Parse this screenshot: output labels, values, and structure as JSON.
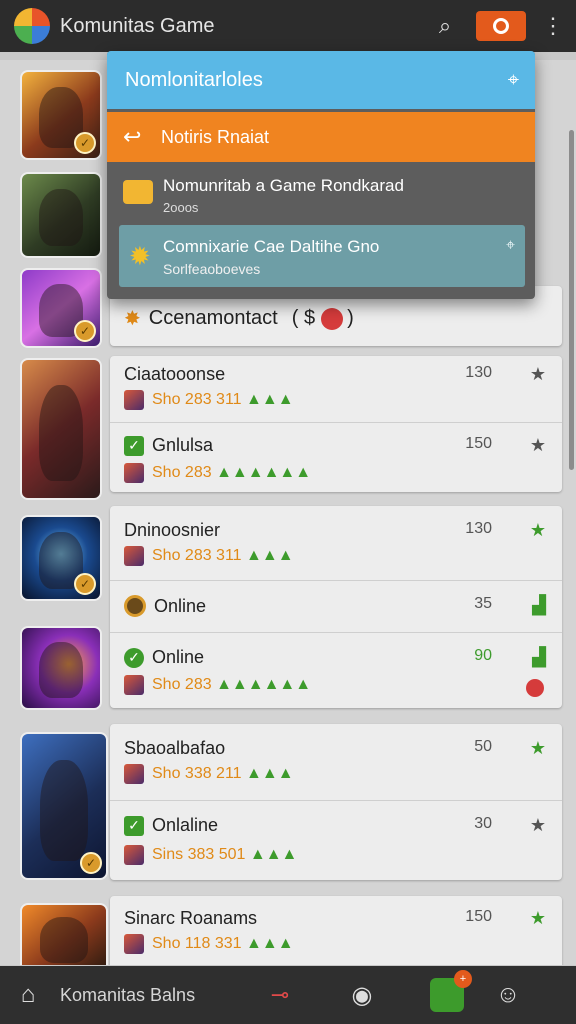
{
  "app": {
    "title": "Komunitas Game"
  },
  "header": {
    "search_icon": "search-icon",
    "record_icon": "record-icon",
    "menu_icon": "more-vertical-icon"
  },
  "dropdown": {
    "header_title": "Nomlonitarloles",
    "pin_icon": "pin-icon",
    "orange_label": "Notiris Rnaiat",
    "item1": {
      "title": "Nomunritab a Game Rondkarad",
      "subtitle": "2ooos"
    },
    "item2": {
      "title": "Comnixarie Cae Daltihe Gno",
      "subtitle": "Sorlfeaoboeves"
    }
  },
  "community_bar": {
    "label": "Ccenamontact",
    "suffix": "( $"
  },
  "players": [
    {
      "name": "Ciaatooonse",
      "count": "130",
      "stat": "Sho 283 311",
      "bars": "▲▲▲"
    },
    {
      "name": "Gnlulsa",
      "count": "150",
      "stat": "Sho 283",
      "bars": "▲▲▲▲▲▲"
    },
    {
      "name": "Dninoosnier",
      "count": "130",
      "stat": "Sho 283 311",
      "bars": "▲▲▲"
    },
    {
      "name": "Online",
      "count": "35"
    },
    {
      "name": "Online",
      "count": "90",
      "stat": "Sho 283",
      "bars": "▲▲▲▲▲▲"
    },
    {
      "name": "Sbaoalbafao",
      "count": "50",
      "stat": "Sho 338 211",
      "bars": "▲▲▲"
    },
    {
      "name": "Onlaline",
      "count": "30",
      "stat": "Sins 383 501",
      "bars": "▲▲▲"
    },
    {
      "name": "Sinarc Roanams",
      "count": "150",
      "stat": "Sho 118 331",
      "bars": "▲▲▲"
    }
  ],
  "bottom_nav": {
    "label": "Komanitas Balns",
    "badge": "+"
  }
}
